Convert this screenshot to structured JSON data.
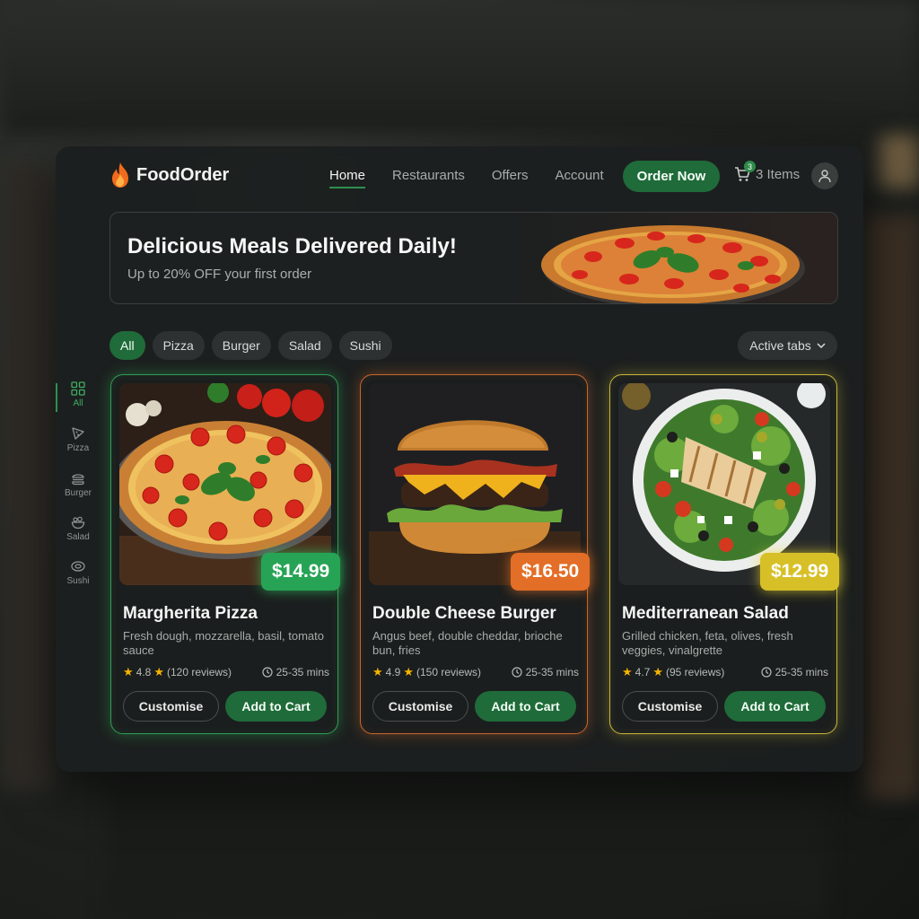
{
  "brand": {
    "name": "FoodOrder"
  },
  "nav": [
    {
      "label": "Home",
      "active": true
    },
    {
      "label": "Restaurants",
      "active": false
    },
    {
      "label": "Offers",
      "active": false
    },
    {
      "label": "Account",
      "active": false
    }
  ],
  "header": {
    "order_now": "Order Now",
    "cart_count": "3",
    "cart_label": "3 Items",
    "cart_icon": "cart-icon",
    "avatar_icon": "user-icon"
  },
  "hero": {
    "title": "Delicious Meals Delivered Daily!",
    "subtitle": "Up to 20% OFF your first order"
  },
  "filters": {
    "chips": [
      {
        "label": "All",
        "active": true
      },
      {
        "label": "Pizza",
        "active": false
      },
      {
        "label": "Burger",
        "active": false
      },
      {
        "label": "Salad",
        "active": false
      },
      {
        "label": "Sushi",
        "active": false
      }
    ],
    "sort_label": "Active tabs"
  },
  "rail": [
    {
      "label": "All",
      "icon": "grid-icon",
      "active": true
    },
    {
      "label": "Pizza",
      "icon": "pizza-icon",
      "active": false
    },
    {
      "label": "Burger",
      "icon": "burger-icon",
      "active": false
    },
    {
      "label": "Salad",
      "icon": "salad-icon",
      "active": false
    },
    {
      "label": "Sushi",
      "icon": "sushi-icon",
      "active": false
    }
  ],
  "cards": [
    {
      "title": "Margherita Pizza",
      "desc": "Fresh dough, mozzarella, basil, tomato sauce",
      "price": "$14.99",
      "rating": "4.8",
      "reviews": "(120 reviews)",
      "time": "25-35 mins",
      "customise": "Customise",
      "add": "Add to Cart",
      "accent": "#2f9c55"
    },
    {
      "title": "Double Cheese Burger",
      "desc": "Angus beef, double cheddar, brioche bun, fries",
      "price": "$16.50",
      "rating": "4.9",
      "reviews": "(150 reviews)",
      "time": "25-35 mins",
      "customise": "Customise",
      "add": "Add to Cart",
      "accent": "#c7672e"
    },
    {
      "title": "Mediterranean Salad",
      "desc": "Grilled chicken, feta, olives, fresh veggies, vinalgrette",
      "price": "$12.99",
      "rating": "4.7",
      "reviews": "(95 reviews)",
      "time": "25-35 mins",
      "customise": "Customise",
      "add": "Add to Cart",
      "accent": "#c9b53c"
    }
  ]
}
